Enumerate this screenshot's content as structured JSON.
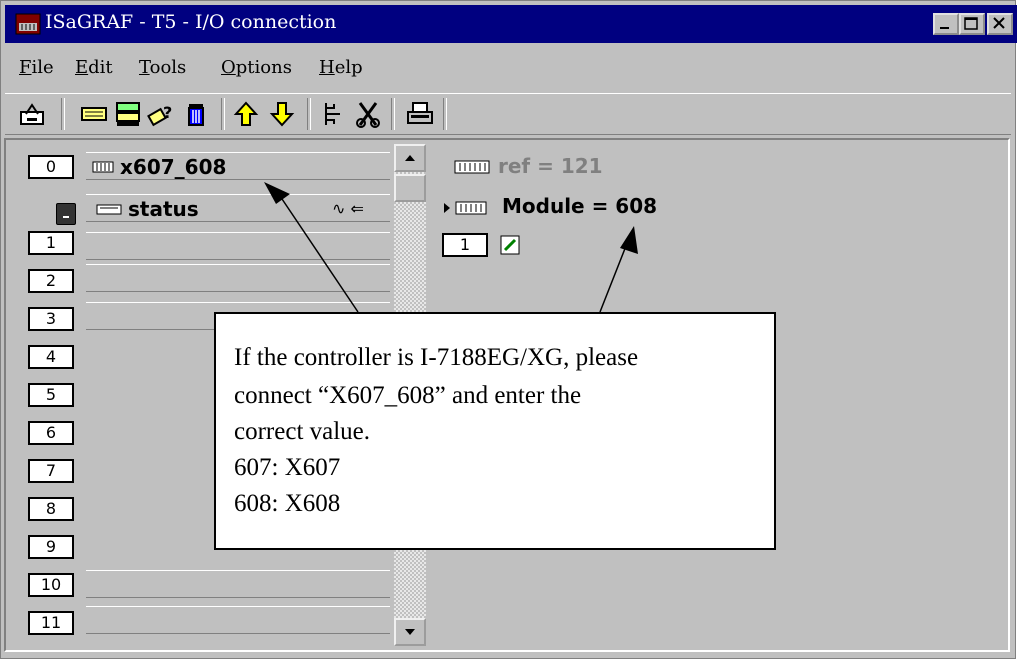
{
  "window": {
    "title": "ISaGRAF - T5 - I/O connection"
  },
  "menu": {
    "items": [
      {
        "ul": "F",
        "rest": "ile"
      },
      {
        "ul": "E",
        "rest": "dit"
      },
      {
        "ul": "T",
        "rest": "ools"
      },
      {
        "ul": "O",
        "rest": "ptions"
      },
      {
        "ul": "H",
        "rest": "elp"
      }
    ]
  },
  "toolbar": {
    "icons": [
      "open-icon",
      "board-icon",
      "board-list-icon",
      "help-board-icon",
      "delete-icon",
      "move-up-icon",
      "move-down-icon",
      "connect-icon",
      "disconnect-icon",
      "print-icon"
    ]
  },
  "slots": {
    "numbers": [
      "0",
      "1",
      "2",
      "3",
      "4",
      "5",
      "6",
      "7",
      "8",
      "9",
      "10",
      "11"
    ],
    "board_name": "x607_608",
    "equipment_name": "status",
    "equipment_symbols": "∿ ⇐"
  },
  "details": {
    "ref": "ref = 121",
    "module": "Module = 608",
    "channel": "1"
  },
  "callout": {
    "lines": [
      "If the controller is I-7188EG/XG, please",
      "connect “X607_608” and enter the",
      "correct value.",
      "607: X607",
      "608: X608"
    ]
  },
  "colors": {
    "titlebar": "#000080",
    "face": "#c0c0c0",
    "ref_text": "#808080"
  }
}
